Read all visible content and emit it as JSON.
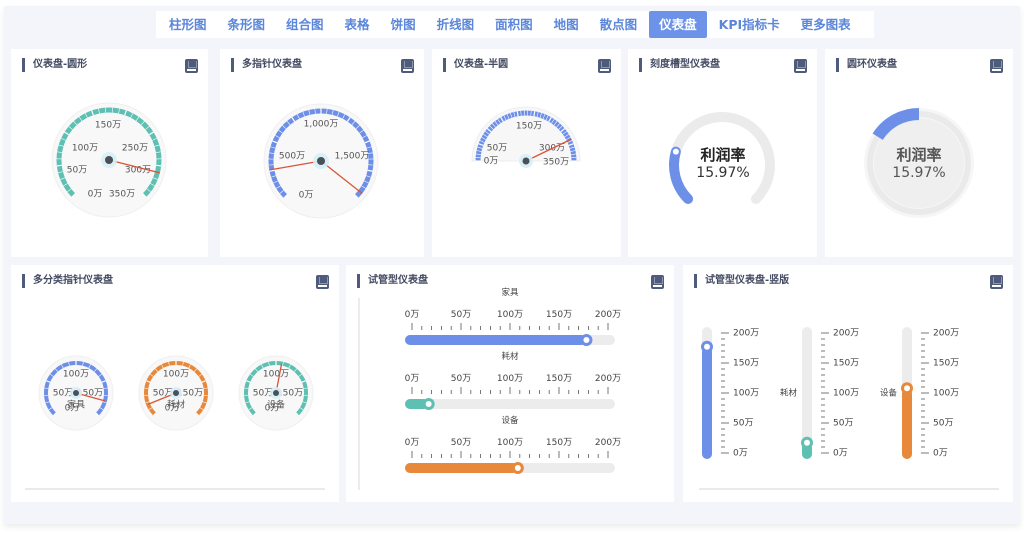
{
  "nav": {
    "tabs": [
      {
        "label": "柱形图",
        "active": false
      },
      {
        "label": "条形图",
        "active": false
      },
      {
        "label": "组合图",
        "active": false
      },
      {
        "label": "表格",
        "active": false
      },
      {
        "label": "饼图",
        "active": false
      },
      {
        "label": "折线图",
        "active": false
      },
      {
        "label": "面积图",
        "active": false
      },
      {
        "label": "地图",
        "active": false
      },
      {
        "label": "散点图",
        "active": false
      },
      {
        "label": "仪表盘",
        "active": true
      },
      {
        "label": "KPI指标卡",
        "active": false
      },
      {
        "label": "更多图表",
        "active": false
      }
    ]
  },
  "colors": {
    "blue": "#6d8fe8",
    "teal": "#5ebfb3",
    "orange": "#e8883a",
    "needle": "#d9553a",
    "track": "#ececec",
    "title_bar": "#4f5b7a"
  },
  "cards": {
    "round": {
      "title": "仪表盘-圆形",
      "icon": "bookmark-icon"
    },
    "multi_pointer": {
      "title": "多指针仪表盘",
      "icon": "bookmark-icon"
    },
    "half": {
      "title": "仪表盘-半圆",
      "icon": "bookmark-icon"
    },
    "scale_ring": {
      "title": "刻度槽型仪表盘",
      "icon": "bookmark-icon",
      "center_title": "利润率",
      "center_value": "15.97%"
    },
    "ring": {
      "title": "圆环仪表盘",
      "icon": "bookmark-icon",
      "center_title": "利润率",
      "center_value": "15.97%"
    },
    "multi_category": {
      "title": "多分类指针仪表盘",
      "icon": "bookmark-icon"
    },
    "tube_h": {
      "title": "试管型仪表盘",
      "icon": "bookmark-icon"
    },
    "tube_v": {
      "title": "试管型仪表盘-竖版",
      "icon": "bookmark-icon"
    }
  },
  "chart_data": [
    {
      "id": "round",
      "type": "gauge",
      "title": "仪表盘-圆形",
      "min": 0,
      "max": 350,
      "unit": "万",
      "tick_labels": [
        "0万",
        "50万",
        "100万",
        "150万",
        "250万",
        "300万",
        "350万"
      ],
      "value": 310,
      "color": "#5ebfb3"
    },
    {
      "id": "multi_pointer",
      "type": "gauge",
      "title": "多指针仪表盘",
      "min": 0,
      "max": 2000,
      "unit": "万",
      "tick_labels": [
        "0万",
        "500万",
        "1,000万",
        "1,500万"
      ],
      "values": [
        260,
        1950
      ],
      "color": "#6d8fe8"
    },
    {
      "id": "half",
      "type": "gauge",
      "title": "仪表盘-半圆",
      "min": 0,
      "max": 350,
      "unit": "万",
      "tick_labels": [
        "0万",
        "50万",
        "150万",
        "300万",
        "350万"
      ],
      "value": 300,
      "color": "#6d8fe8"
    },
    {
      "id": "scale_ring",
      "type": "gauge",
      "title": "刻度槽型仪表盘",
      "label": "利润率",
      "value_percent": 15.97,
      "color": "#6d8fe8"
    },
    {
      "id": "ring",
      "type": "gauge",
      "title": "圆环仪表盘",
      "label": "利润率",
      "value_percent": 15.97,
      "color": "#6d8fe8"
    },
    {
      "id": "multi_category",
      "type": "gauge",
      "title": "多分类指针仪表盘",
      "min": 0,
      "max": 200,
      "unit": "万",
      "tick_labels": [
        "0万",
        "50万",
        "100万",
        "150万"
      ],
      "series": [
        {
          "name": "家具",
          "value": 178,
          "color": "#6d8fe8"
        },
        {
          "name": "耗材",
          "value": 17,
          "color": "#e8883a"
        },
        {
          "name": "设备",
          "value": 108,
          "color": "#5ebfb3"
        }
      ]
    },
    {
      "id": "tube_h",
      "type": "bar",
      "title": "试管型仪表盘",
      "orientation": "horizontal",
      "min": 0,
      "max": 200,
      "unit": "万",
      "tick_labels": [
        "0万",
        "50万",
        "100万",
        "150万",
        "200万"
      ],
      "series": [
        {
          "name": "家具",
          "value": 178,
          "color": "#6d8fe8"
        },
        {
          "name": "耗材",
          "value": 17,
          "color": "#5ebfb3"
        },
        {
          "name": "设备",
          "value": 108,
          "color": "#e8883a"
        }
      ]
    },
    {
      "id": "tube_v",
      "type": "bar",
      "title": "试管型仪表盘-竖版",
      "orientation": "vertical",
      "min": 0,
      "max": 200,
      "unit": "万",
      "tick_labels": [
        "0万",
        "50万",
        "100万",
        "150万",
        "200万"
      ],
      "series": [
        {
          "name": "家具",
          "value": 177,
          "color": "#6d8fe8",
          "label_visible": false
        },
        {
          "name": "耗材",
          "value": 17,
          "color": "#5ebfb3",
          "label_visible": true
        },
        {
          "name": "设备",
          "value": 108,
          "color": "#e8883a",
          "label_visible": true
        }
      ]
    }
  ]
}
